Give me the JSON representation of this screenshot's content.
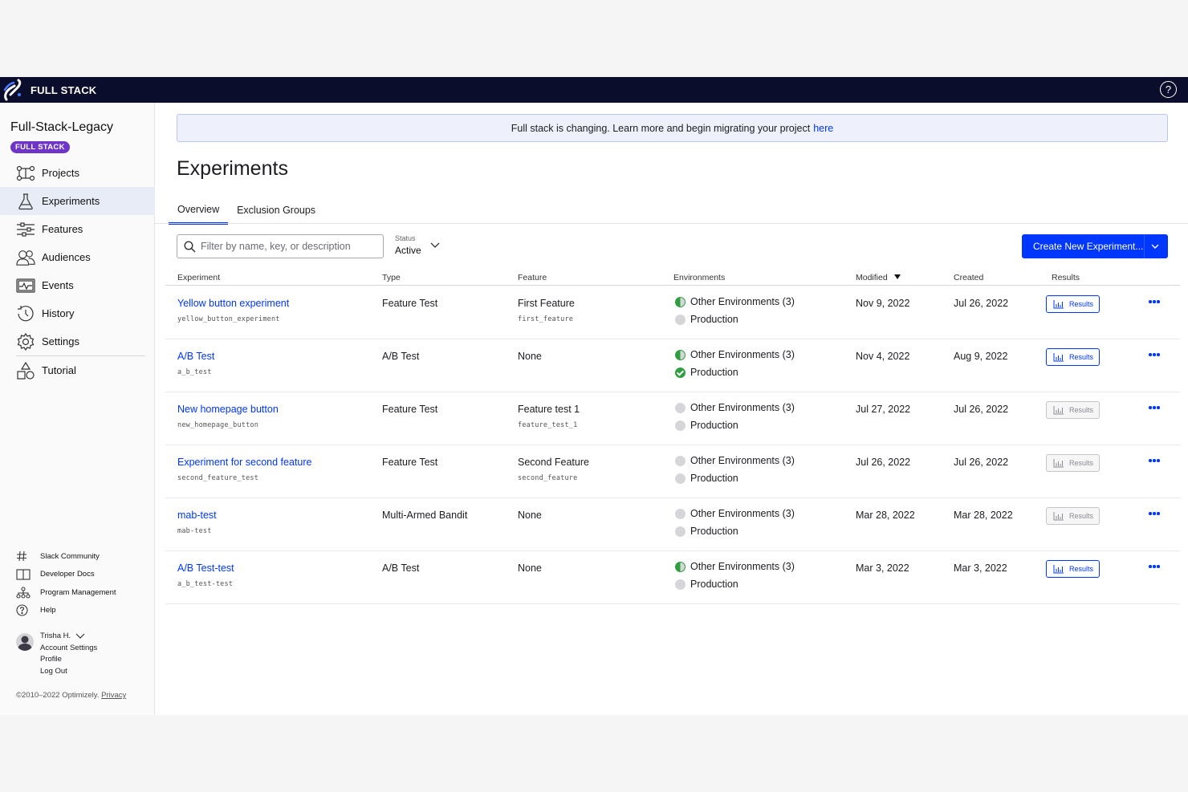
{
  "app": {
    "brand": "FULL STACK"
  },
  "sidebar": {
    "project_title": "Full-Stack-Legacy",
    "badge": "FULL STACK",
    "nav": [
      {
        "label": "Projects",
        "icon": "projects-icon"
      },
      {
        "label": "Experiments",
        "icon": "flask-icon",
        "active": true
      },
      {
        "label": "Features",
        "icon": "sliders-icon"
      },
      {
        "label": "Audiences",
        "icon": "people-icon"
      },
      {
        "label": "Events",
        "icon": "events-icon"
      },
      {
        "label": "History",
        "icon": "history-icon"
      },
      {
        "label": "Settings",
        "icon": "gear-icon"
      },
      {
        "label": "Tutorial",
        "icon": "shapes-icon"
      }
    ],
    "footer_links": [
      {
        "label": "Slack Community",
        "icon": "hash-icon"
      },
      {
        "label": "Developer Docs",
        "icon": "book-icon"
      },
      {
        "label": "Program Management",
        "icon": "hierarchy-icon"
      },
      {
        "label": "Help",
        "icon": "help-circle-icon"
      }
    ],
    "user": {
      "name": "Trisha H.",
      "links": [
        "Account Settings",
        "Profile",
        "Log Out"
      ]
    },
    "copyright": "©2010–2022 Optimizely.",
    "privacy": "Privacy"
  },
  "banner": {
    "text": "Full stack is changing. Learn more and begin migrating your project",
    "link": "here"
  },
  "page": {
    "title": "Experiments"
  },
  "tabs": [
    {
      "label": "Overview",
      "active": true
    },
    {
      "label": "Exclusion Groups"
    }
  ],
  "filter": {
    "placeholder": "Filter by name, key, or description",
    "value": ""
  },
  "status": {
    "label": "Status",
    "value": "Active"
  },
  "create_button": "Create New Experiment...",
  "table": {
    "headers": {
      "experiment": "Experiment",
      "type": "Type",
      "feature": "Feature",
      "environments": "Environments",
      "modified": "Modified",
      "created": "Created",
      "results": "Results"
    },
    "sort_column": "Modified",
    "sort_direction": "descending",
    "results_label": "Results",
    "rows": [
      {
        "name": "Yellow button experiment",
        "key": "yellow_button_experiment",
        "type": "Feature Test",
        "feature": "First Feature",
        "feature_key": "first_feature",
        "env_other": "Other Environments (3)",
        "env_other_status": "partial",
        "env_prod": "Production",
        "env_prod_status": "off",
        "modified": "Nov 9, 2022",
        "created": "Jul 26, 2022",
        "results_enabled": true
      },
      {
        "name": "A/B Test",
        "key": "a_b_test",
        "type": "A/B Test",
        "feature": "None",
        "feature_key": "",
        "env_other": "Other Environments (3)",
        "env_other_status": "partial",
        "env_prod": "Production",
        "env_prod_status": "on",
        "modified": "Nov 4, 2022",
        "created": "Aug 9, 2022",
        "results_enabled": true
      },
      {
        "name": "New homepage button",
        "key": "new_homepage_button",
        "type": "Feature Test",
        "feature": "Feature test 1",
        "feature_key": "feature_test_1",
        "env_other": "Other Environments (3)",
        "env_other_status": "off",
        "env_prod": "Production",
        "env_prod_status": "off",
        "modified": "Jul 27, 2022",
        "created": "Jul 26, 2022",
        "results_enabled": false
      },
      {
        "name": "Experiment for second feature",
        "key": "second_feature_test",
        "type": "Feature Test",
        "feature": "Second Feature",
        "feature_key": "second_feature",
        "env_other": "Other Environments (3)",
        "env_other_status": "off",
        "env_prod": "Production",
        "env_prod_status": "off",
        "modified": "Jul 26, 2022",
        "created": "Jul 26, 2022",
        "results_enabled": false
      },
      {
        "name": "mab-test",
        "key": "mab-test",
        "type": "Multi-Armed Bandit",
        "feature": "None",
        "feature_key": "",
        "env_other": "Other Environments (3)",
        "env_other_status": "off",
        "env_prod": "Production",
        "env_prod_status": "off",
        "modified": "Mar 28, 2022",
        "created": "Mar 28, 2022",
        "results_enabled": false
      },
      {
        "name": "A/B Test-test",
        "key": "a_b_test-test",
        "type": "A/B Test",
        "feature": "None",
        "feature_key": "",
        "env_other": "Other Environments (3)",
        "env_other_status": "partial",
        "env_prod": "Production",
        "env_prod_status": "off",
        "modified": "Mar 3, 2022",
        "created": "Mar 3, 2022",
        "results_enabled": true
      }
    ]
  },
  "colors": {
    "topbar": "#0b0d2c",
    "accent": "#0037ff",
    "badge": "#6e35c7",
    "env_on": "#2e9e3f",
    "env_off": "#d6d6da"
  }
}
